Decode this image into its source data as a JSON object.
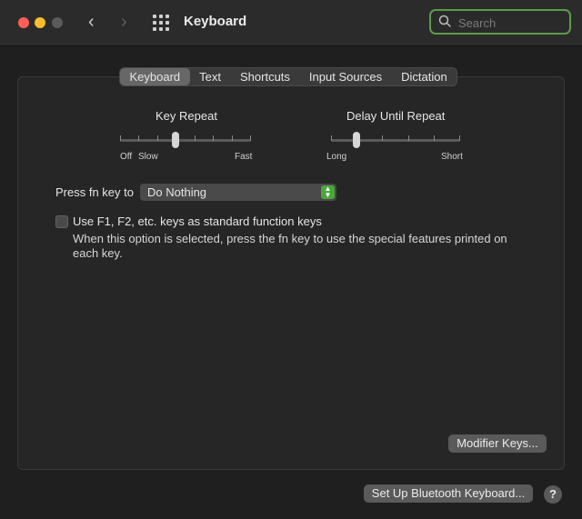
{
  "window": {
    "title": "Keyboard"
  },
  "search": {
    "placeholder": "Search",
    "value": ""
  },
  "tabs": [
    {
      "label": "Keyboard",
      "active": true
    },
    {
      "label": "Text",
      "active": false
    },
    {
      "label": "Shortcuts",
      "active": false
    },
    {
      "label": "Input Sources",
      "active": false
    },
    {
      "label": "Dictation",
      "active": false
    }
  ],
  "key_repeat": {
    "label": "Key Repeat",
    "min_label": "Off",
    "slow_label": "Slow",
    "max_label": "Fast",
    "ticks": 8,
    "level": 3
  },
  "delay_until_repeat": {
    "label": "Delay Until Repeat",
    "min_label": "Long",
    "max_label": "Short",
    "ticks": 6,
    "level": 1
  },
  "fn_key": {
    "label": "Press fn key to",
    "selected": "Do Nothing"
  },
  "function_keys": {
    "checked": false,
    "label": "Use F1, F2, etc. keys as standard function keys",
    "description": "When this option is selected, press the fn key to use the special features printed on each key."
  },
  "buttons": {
    "modifier_keys": "Modifier Keys...",
    "bluetooth": "Set Up Bluetooth Keyboard...",
    "help": "?"
  },
  "colors": {
    "accent_green": "#4aa83a",
    "search_focus": "#5f9a4c",
    "close": "#ff5f57",
    "minimize": "#febc2e"
  }
}
